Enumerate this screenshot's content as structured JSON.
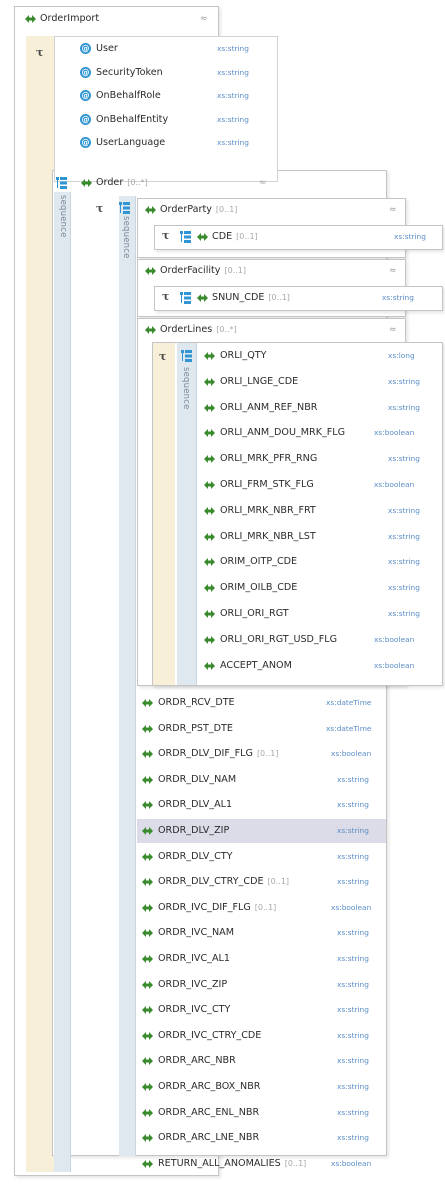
{
  "root": {
    "name": "OrderImport",
    "collapse": "≈"
  },
  "attributes": [
    {
      "name": "User",
      "type": "xs:string"
    },
    {
      "name": "SecurityToken",
      "type": "xs:string"
    },
    {
      "name": "OnBehalfRole",
      "type": "xs:string"
    },
    {
      "name": "OnBehalfEntity",
      "type": "xs:string"
    },
    {
      "name": "UserLanguage",
      "type": "xs:string"
    }
  ],
  "order": {
    "name": "Order",
    "card": "[0..*]",
    "collapse": "≈",
    "seq_label": "sequence"
  },
  "order_seq_label": "sequence",
  "order_party": {
    "name": "OrderParty",
    "card": "[0..1]",
    "collapse": "≈",
    "child": {
      "name": "CDE",
      "card": "[0..1]",
      "type": "xs:string"
    }
  },
  "order_facility": {
    "name": "OrderFacility",
    "card": "[0..1]",
    "collapse": "≈",
    "child": {
      "name": "SNUN_CDE",
      "card": "[0..1]",
      "type": "xs:string"
    }
  },
  "order_lines": {
    "name": "OrderLines",
    "card": "[0..*]",
    "collapse": "≈",
    "seq_label": "sequence",
    "items": [
      {
        "name": "ORLI_QTY",
        "type": "xs:long"
      },
      {
        "name": "ORLI_LNGE_CDE",
        "type": "xs:string"
      },
      {
        "name": "ORLI_ANM_REF_NBR",
        "type": "xs:string"
      },
      {
        "name": "ORLI_ANM_DOU_MRK_FLG",
        "type": "xs:boolean"
      },
      {
        "name": "ORLI_MRK_PFR_RNG",
        "type": "xs:string"
      },
      {
        "name": "ORLI_FRM_STK_FLG",
        "type": "xs:boolean"
      },
      {
        "name": "ORLI_MRK_NBR_FRT",
        "type": "xs:string"
      },
      {
        "name": "ORLI_MRK_NBR_LST",
        "type": "xs:string"
      },
      {
        "name": "ORIM_OITP_CDE",
        "type": "xs:string"
      },
      {
        "name": "ORIM_OILB_CDE",
        "type": "xs:string"
      },
      {
        "name": "ORLI_ORI_RGT",
        "type": "xs:string"
      },
      {
        "name": "ORLI_ORI_RGT_USD_FLG",
        "type": "xs:boolean"
      },
      {
        "name": "ACCEPT_ANOM",
        "type": "xs:boolean"
      }
    ]
  },
  "order_fields": [
    {
      "name": "ORDR_RCV_DTE",
      "card": "",
      "type": "xs:dateTime"
    },
    {
      "name": "ORDR_PST_DTE",
      "card": "",
      "type": "xs:dateTime"
    },
    {
      "name": "ORDR_DLV_DIF_FLG",
      "card": "[0..1]",
      "type": "xs:boolean"
    },
    {
      "name": "ORDR_DLV_NAM",
      "card": "",
      "type": "xs:string"
    },
    {
      "name": "ORDR_DLV_AL1",
      "card": "",
      "type": "xs:string"
    },
    {
      "name": "ORDR_DLV_ZIP",
      "card": "",
      "type": "xs:string",
      "selected": true
    },
    {
      "name": "ORDR_DLV_CTY",
      "card": "",
      "type": "xs:string"
    },
    {
      "name": "ORDR_DLV_CTRY_CDE",
      "card": "[0..1]",
      "type": "xs:string"
    },
    {
      "name": "ORDR_IVC_DIF_FLG",
      "card": "[0..1]",
      "type": "xs:boolean"
    },
    {
      "name": "ORDR_IVC_NAM",
      "card": "",
      "type": "xs:string"
    },
    {
      "name": "ORDR_IVC_AL1",
      "card": "",
      "type": "xs:string"
    },
    {
      "name": "ORDR_IVC_ZIP",
      "card": "",
      "type": "xs:string"
    },
    {
      "name": "ORDR_IVC_CTY",
      "card": "",
      "type": "xs:string"
    },
    {
      "name": "ORDR_IVC_CTRY_CDE",
      "card": "",
      "type": "xs:string"
    },
    {
      "name": "ORDR_ARC_NBR",
      "card": "",
      "type": "xs:string"
    },
    {
      "name": "ORDR_ARC_BOX_NBR",
      "card": "",
      "type": "xs:string"
    },
    {
      "name": "ORDR_ARC_ENL_NBR",
      "card": "",
      "type": "xs:string"
    },
    {
      "name": "ORDR_ARC_LNE_NBR",
      "card": "",
      "type": "xs:string"
    },
    {
      "name": "RETURN_ALL_ANOMALIES",
      "card": "[0..1]",
      "type": "xs:boolean"
    }
  ],
  "colors": {
    "element_icon": "#3a8a2e",
    "attribute_icon": "#2f95d4",
    "type_text": "#5a8ec6",
    "selected_row": "#dcdce8",
    "beige": "#f7efd8"
  }
}
